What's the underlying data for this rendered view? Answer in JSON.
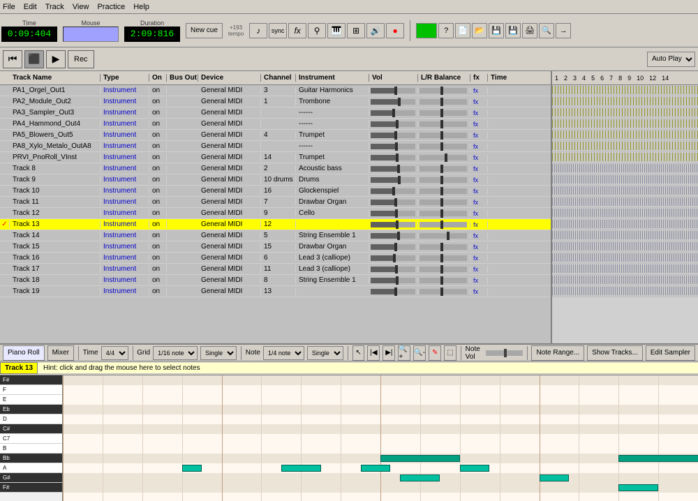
{
  "menubar": {
    "items": [
      "File",
      "Edit",
      "Track",
      "View",
      "Practice",
      "Help"
    ]
  },
  "toolbar": {
    "time_label": "Time",
    "mouse_label": "Mouse",
    "duration_label": "Duration",
    "new_cue_label": "New cue",
    "current_time": "0:09:404",
    "duration_time": "2:09:816",
    "tempo_label": "+193",
    "tempo_sub": "tempo",
    "rec_label": "Rec",
    "autoplay": "Auto Play",
    "sync_label": "sync"
  },
  "track_headers": {
    "check": "",
    "name": "Track Name",
    "type": "Type",
    "on": "On",
    "bus_out": "Bus Out",
    "device": "Device",
    "channel": "Channel",
    "instrument": "Instrument",
    "vol": "Vol",
    "balance": "L/R Balance",
    "fx": "fx",
    "time": "Time"
  },
  "tracks": [
    {
      "check": false,
      "name": "PA1_Orgel_Out1",
      "type": "Instrument",
      "on": "on",
      "bus_out": "",
      "device": "General MIDI",
      "channel": "3",
      "instrument": "Guitar Harmonics",
      "vol": 60,
      "balance": 50,
      "fx": "fx",
      "active": false
    },
    {
      "check": false,
      "name": "PA2_Module_Out2",
      "type": "Instrument",
      "on": "on",
      "bus_out": "",
      "device": "General MIDI",
      "channel": "1",
      "instrument": "Trombone",
      "vol": 70,
      "balance": 50,
      "fx": "fx",
      "active": false
    },
    {
      "check": false,
      "name": "PA3_Sampler_Out3",
      "type": "Instrument",
      "on": "on",
      "bus_out": "",
      "device": "General MIDI",
      "channel": "",
      "instrument": "------",
      "vol": 55,
      "balance": 50,
      "fx": "fx",
      "active": false
    },
    {
      "check": false,
      "name": "PA4_Hammond_Out4",
      "type": "Instrument",
      "on": "on",
      "bus_out": "",
      "device": "General MIDI",
      "channel": "",
      "instrument": "------",
      "vol": 65,
      "balance": 50,
      "fx": "fx",
      "active": false
    },
    {
      "check": false,
      "name": "PA5_Blowers_Out5",
      "type": "Instrument",
      "on": "on",
      "bus_out": "",
      "device": "General MIDI",
      "channel": "4",
      "instrument": "Trumpet",
      "vol": 60,
      "balance": 50,
      "fx": "fx",
      "active": false
    },
    {
      "check": false,
      "name": "PA8_Xylo_Metalo_OutA8",
      "type": "Instrument",
      "on": "on",
      "bus_out": "",
      "device": "General MIDI",
      "channel": "",
      "instrument": "------",
      "vol": 62,
      "balance": 50,
      "fx": "fx",
      "active": false
    },
    {
      "check": false,
      "name": "PRVI_PnoRoll_VInst",
      "type": "Instrument",
      "on": "on",
      "bus_out": "",
      "device": "General MIDI",
      "channel": "14",
      "instrument": "Trumpet",
      "vol": 65,
      "balance": 60,
      "fx": "fx",
      "active": false
    },
    {
      "check": false,
      "name": "Track 8",
      "type": "Instrument",
      "on": "on",
      "bus_out": "",
      "device": "General MIDI",
      "channel": "2",
      "instrument": "Acoustic bass",
      "vol": 68,
      "balance": 50,
      "fx": "fx",
      "active": false
    },
    {
      "check": false,
      "name": "Track 9",
      "type": "Instrument",
      "on": "on",
      "bus_out": "",
      "device": "General MIDI",
      "channel": "10 drums",
      "instrument": "Drums",
      "vol": 70,
      "balance": 50,
      "fx": "fx",
      "active": false
    },
    {
      "check": false,
      "name": "Track 10",
      "type": "Instrument",
      "on": "on",
      "bus_out": "",
      "device": "General MIDI",
      "channel": "16",
      "instrument": "Glockenspiel",
      "vol": 55,
      "balance": 50,
      "fx": "fx",
      "active": false
    },
    {
      "check": false,
      "name": "Track 11",
      "type": "Instrument",
      "on": "on",
      "bus_out": "",
      "device": "General MIDI",
      "channel": "7",
      "instrument": "Drawbar Organ",
      "vol": 60,
      "balance": 50,
      "fx": "fx",
      "active": false
    },
    {
      "check": false,
      "name": "Track 12",
      "type": "Instrument",
      "on": "on",
      "bus_out": "",
      "device": "General MIDI",
      "channel": "9",
      "instrument": "Cello",
      "vol": 62,
      "balance": 50,
      "fx": "fx",
      "active": false
    },
    {
      "check": true,
      "name": "Track 13",
      "type": "Instrument",
      "on": "on",
      "bus_out": "",
      "device": "General MIDI",
      "channel": "12",
      "instrument": "",
      "vol": 65,
      "balance": 50,
      "fx": "fx",
      "active": true
    },
    {
      "check": false,
      "name": "Track 14",
      "type": "Instrument",
      "on": "on",
      "bus_out": "",
      "device": "General MIDI",
      "channel": "5",
      "instrument": "String Ensemble 1",
      "vol": 68,
      "balance": 65,
      "fx": "fx",
      "active": false
    },
    {
      "check": false,
      "name": "Track 15",
      "type": "Instrument",
      "on": "on",
      "bus_out": "",
      "device": "General MIDI",
      "channel": "15",
      "instrument": "Drawbar Organ",
      "vol": 60,
      "balance": 50,
      "fx": "fx",
      "active": false
    },
    {
      "check": false,
      "name": "Track 16",
      "type": "Instrument",
      "on": "on",
      "bus_out": "",
      "device": "General MIDI",
      "channel": "6",
      "instrument": "Lead 3 (calliope)",
      "vol": 58,
      "balance": 50,
      "fx": "fx",
      "active": false
    },
    {
      "check": false,
      "name": "Track 17",
      "type": "Instrument",
      "on": "on",
      "bus_out": "",
      "device": "General MIDI",
      "channel": "11",
      "instrument": "Lead 3 (calliope)",
      "vol": 62,
      "balance": 50,
      "fx": "fx",
      "active": false
    },
    {
      "check": false,
      "name": "Track 18",
      "type": "Instrument",
      "on": "on",
      "bus_out": "",
      "device": "General MIDI",
      "channel": "8",
      "instrument": "String Ensemble 1",
      "vol": 65,
      "balance": 50,
      "fx": "fx",
      "active": false
    },
    {
      "check": false,
      "name": "Track 19",
      "type": "Instrument",
      "on": "on",
      "bus_out": "",
      "device": "General MIDI",
      "channel": "13",
      "instrument": "",
      "vol": 60,
      "balance": 50,
      "fx": "fx",
      "active": false
    }
  ],
  "piano_roll": {
    "label": "Track 13",
    "hint": "Hint: click and drag the mouse here to select notes",
    "toolbar": {
      "piano_roll_label": "Piano Roll",
      "mixer_label": "Mixer",
      "time_label": "Time",
      "time_sig": "4/4",
      "grid_label": "Grid",
      "grid_val": "1/16 note",
      "single1": "Single",
      "note_label": "Note",
      "note_val": "1/4 note",
      "single2": "Single",
      "note_vol_label": "Note Vol",
      "note_range_label": "Note Range...",
      "show_tracks_label": "Show Tracks...",
      "edit_sampler_label": "Edit Sampler"
    },
    "keys": [
      {
        "note": "F#",
        "black": true
      },
      {
        "note": "F",
        "black": false
      },
      {
        "note": "E",
        "black": false
      },
      {
        "note": "Eb",
        "black": true
      },
      {
        "note": "D",
        "black": false
      },
      {
        "note": "C#",
        "black": true
      },
      {
        "note": "C7",
        "black": false
      },
      {
        "note": "B",
        "black": false
      },
      {
        "note": "Bb",
        "black": true
      },
      {
        "note": "A",
        "black": false
      },
      {
        "note": "G#",
        "black": true
      },
      {
        "note": "F#",
        "black": true
      }
    ]
  },
  "colors": {
    "toolbar_bg": "#d4d0c8",
    "selected_track": "#ffff00",
    "instrument_color": "#0000cc",
    "note_color": "#00c0a0",
    "timeline_pattern": "#888800"
  }
}
